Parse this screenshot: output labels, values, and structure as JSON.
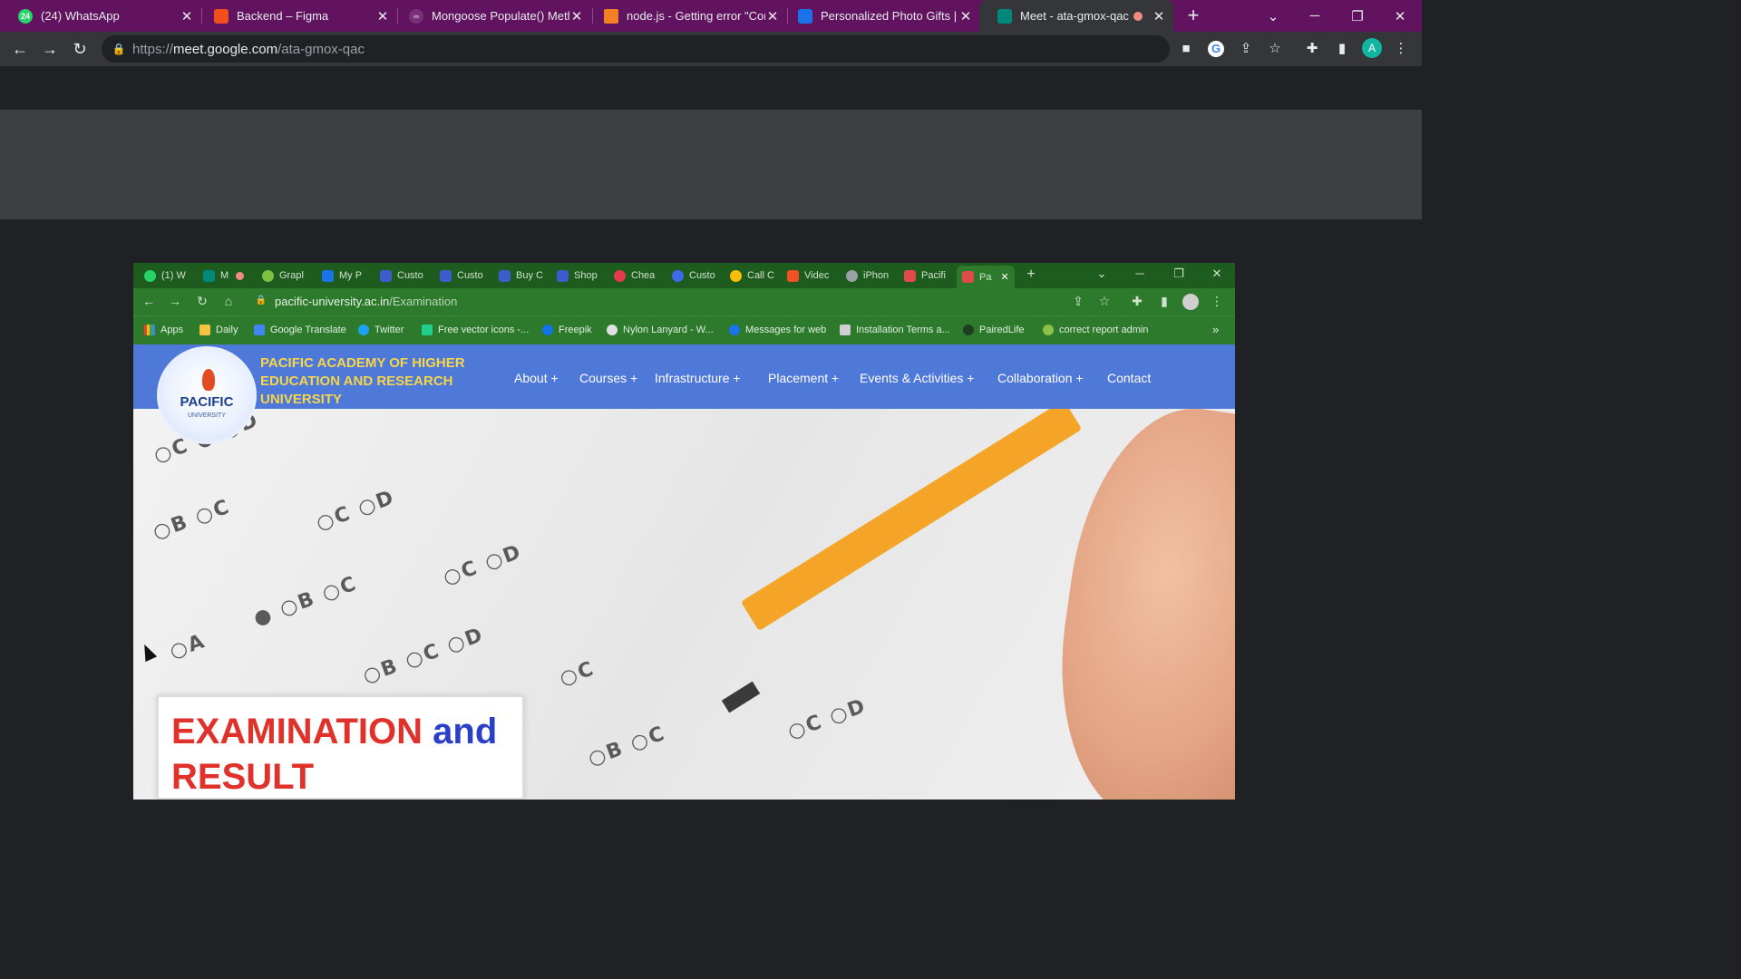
{
  "browser": {
    "tabs": [
      {
        "title": "(24) WhatsApp",
        "favicon": "whatsapp-icon",
        "badge": "24"
      },
      {
        "title": "Backend – Figma",
        "favicon": "figma-icon"
      },
      {
        "title": "Mongoose Populate() Meth",
        "favicon": "mongoose-icon"
      },
      {
        "title": "node.js - Getting error \"Cor",
        "favicon": "stackoverflow-icon"
      },
      {
        "title": "Personalized Photo Gifts | V",
        "favicon": "vistaprint-icon"
      },
      {
        "title": "Meet - ata-gmox-qac",
        "favicon": "meet-icon",
        "active": true
      }
    ],
    "url_prefix": "https://",
    "url_host": "meet.google.com",
    "url_path": "/ata-gmox-qac",
    "profile_initial": "A"
  },
  "shared_screen": {
    "tabs": [
      "(1) W",
      "M",
      "Grapl",
      "My P",
      "Custo",
      "Custo",
      "Buy C",
      "Shop",
      "Chea",
      "Custo",
      "Call C",
      "Videc",
      "iPhon",
      "Pacifi",
      "Pa"
    ],
    "url_host": "pacific-university.ac.in",
    "url_path": "/Examination",
    "bookmarks": [
      "Apps",
      "Daily",
      "Google Translate",
      "Twitter",
      "Free vector icons -...",
      "Freepik",
      "Nylon Lanyard - W...",
      "Messages for web",
      "Installation Terms a...",
      "PairedLife",
      "correct report admin"
    ],
    "bookmarks_more": "»",
    "site": {
      "logo_text": "PACIFIC",
      "logo_subtext": "UNIVERSITY",
      "name_lines": [
        "PACIFIC ACADEMY OF HIGHER",
        "EDUCATION AND RESEARCH",
        "UNIVERSITY"
      ],
      "menu": [
        "About +",
        "Courses +",
        "Infrastructure +",
        "Placement +",
        "Events & Activities +",
        "Collaboration +",
        "Contact"
      ],
      "hero_title_part1": "EXAMINATION",
      "hero_title_part2": "and",
      "hero_title_line2": "RESULT"
    }
  },
  "colors": {
    "tabstrip": "#61135f",
    "toolbar": "#35363a",
    "inner_chrome": "#2d7a2d",
    "site_nav": "#4f79d9",
    "title_red": "#e0312b",
    "title_blue": "#2a3fc7"
  }
}
